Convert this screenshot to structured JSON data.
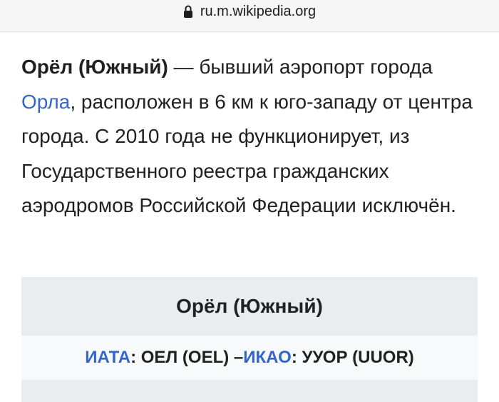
{
  "browser": {
    "url": "ru.m.wikipedia.org"
  },
  "article": {
    "title_bold": "Орёл (Южный)",
    "intro_after_title": " — бывший аэропорт города ",
    "link_city": "Орла",
    "intro_rest": ", расположен в 6 км к юго-западу от центра города. С 2010 года не функционирует, из Государственного реестра гражданских аэродромов Российской Федерации исключён."
  },
  "infobox": {
    "title": "Орёл (Южный)",
    "iata_label": "ИАТА",
    "iata_value": ": ОЕЛ (OEL) – ",
    "icao_label": "ИКАО",
    "icao_value": ": УУОР (UUOR)"
  }
}
